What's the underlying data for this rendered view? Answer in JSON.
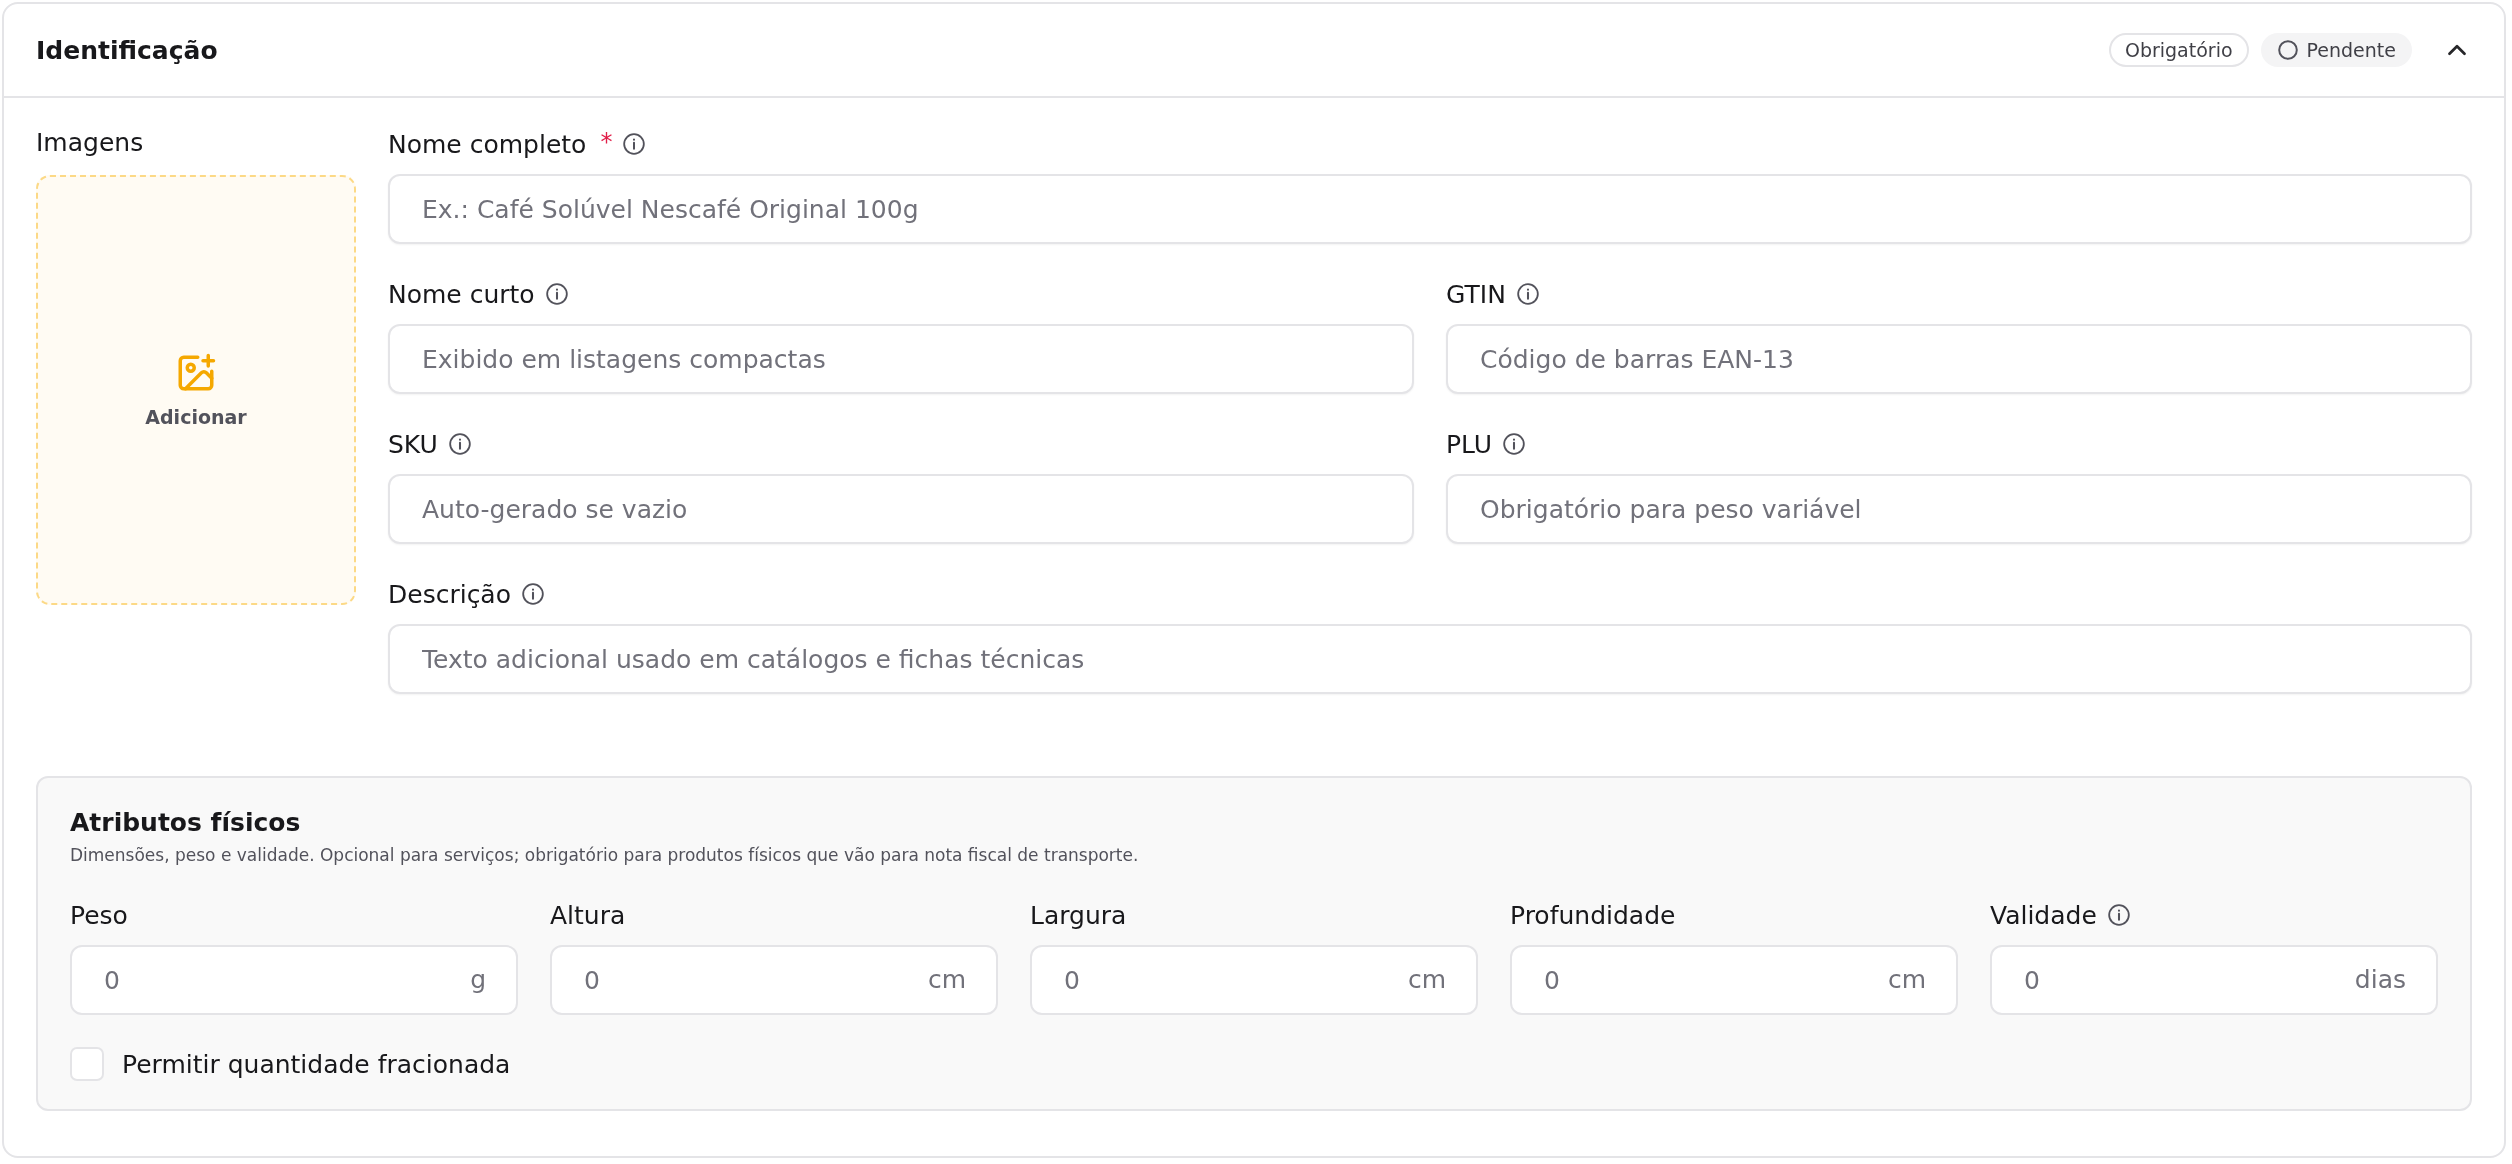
{
  "section": {
    "title": "Identificação",
    "badges": [
      {
        "kind": "outline",
        "label": "Obrigatório"
      },
      {
        "kind": "status",
        "label": "Pendente"
      }
    ],
    "expanded": true
  },
  "images": {
    "label": "Imagens",
    "add_label": "Adicionar"
  },
  "field_rows": [
    [
      {
        "label": "Nome completo",
        "required_mark": "*",
        "info": true,
        "placeholder": "Ex.: Café Solúvel Nescafé Original 100g"
      }
    ],
    [
      {
        "label": "Nome curto",
        "info": true,
        "placeholder": "Exibido em listagens compactas"
      },
      {
        "label": "GTIN",
        "info": true,
        "placeholder": "Código de barras EAN-13"
      }
    ],
    [
      {
        "label": "SKU",
        "info": true,
        "placeholder": "Auto-gerado se vazio"
      },
      {
        "label": "PLU",
        "info": true,
        "placeholder": "Obrigatório para peso variável"
      }
    ],
    [
      {
        "label": "Descrição",
        "info": true,
        "placeholder": "Texto adicional usado em catálogos e fichas técnicas"
      }
    ]
  ],
  "physical": {
    "title": "Atributos físicos",
    "subtitle": "Dimensões, peso e validade. Opcional para serviços; obrigatório para produtos físicos que vão para nota fiscal de transporte.",
    "fields": [
      {
        "label": "Peso",
        "info": false,
        "placeholder": "0",
        "unit": "g"
      },
      {
        "label": "Altura",
        "info": false,
        "placeholder": "0",
        "unit": "cm"
      },
      {
        "label": "Largura",
        "info": false,
        "placeholder": "0",
        "unit": "cm"
      },
      {
        "label": "Profundidade",
        "info": false,
        "placeholder": "0",
        "unit": "cm"
      },
      {
        "label": "Validade",
        "info": true,
        "placeholder": "0",
        "unit": "dias"
      }
    ],
    "fractional": {
      "label": "Permitir quantidade fracionada",
      "checked": false
    }
  }
}
